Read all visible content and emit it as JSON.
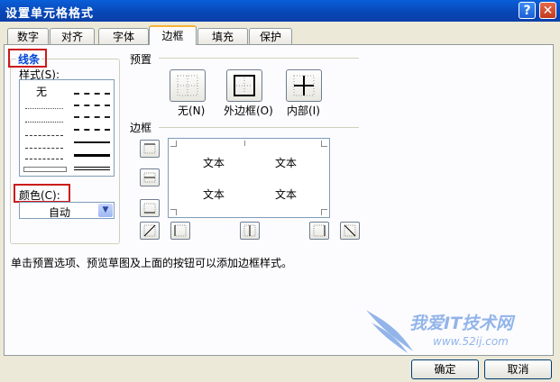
{
  "window": {
    "title": "设置单元格格式"
  },
  "tabs": [
    {
      "label": "数字"
    },
    {
      "label": "对齐"
    },
    {
      "label": "字体"
    },
    {
      "label": "边框"
    },
    {
      "label": "填充"
    },
    {
      "label": "保护"
    }
  ],
  "active_tab": "边框",
  "line_group": {
    "title": "线条",
    "style_label": "样式(S):",
    "none_label": "无",
    "color_label": "颜色(C):",
    "color_value": "自动"
  },
  "preset_group": {
    "title": "预置",
    "items": [
      {
        "label": "无(N)"
      },
      {
        "label": "外边框(O)"
      },
      {
        "label": "内部(I)"
      }
    ]
  },
  "border_group": {
    "title": "边框",
    "preview_texts": [
      "文本",
      "文本",
      "文本",
      "文本"
    ]
  },
  "hint": "单击预置选项、预览草图及上面的按钮可以添加边框样式。",
  "buttons": {
    "ok": "确定",
    "cancel": "取消"
  },
  "watermark": {
    "text": "我爱IT技术网",
    "url": "www.52ij.com"
  },
  "colors": {
    "title_bar": "#0a5fd8",
    "highlight_border": "#cc1a1a",
    "group_title": "#0046d5",
    "active_tab_top": "#f7b233"
  }
}
